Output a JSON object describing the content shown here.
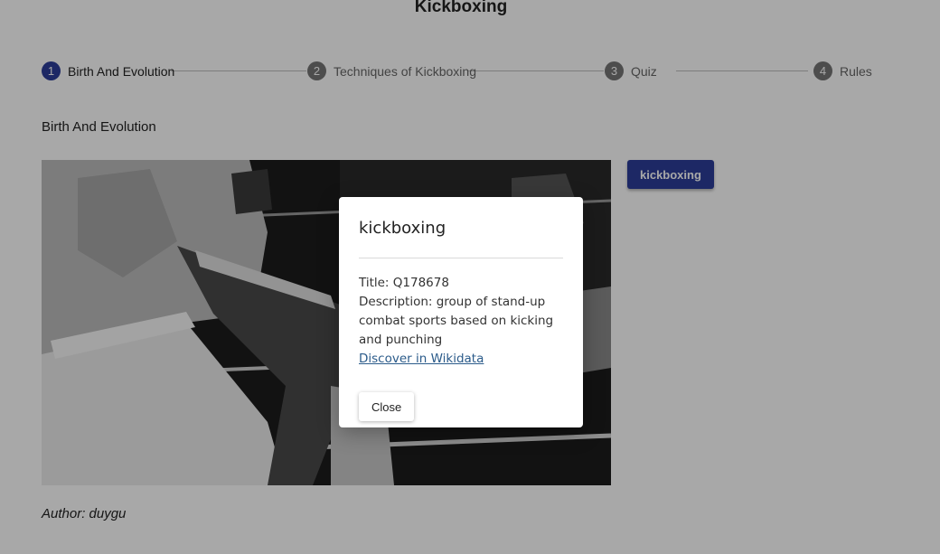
{
  "page": {
    "title": "Kickboxing"
  },
  "colors": {
    "primary": "#2c3e99",
    "step_inactive": "#757575",
    "overlay": "rgba(0,0,0,0.34)"
  },
  "stepper": {
    "steps": [
      {
        "number": "1",
        "label": "Birth And Evolution",
        "active": true
      },
      {
        "number": "2",
        "label": "Techniques of Kickboxing",
        "active": false
      },
      {
        "number": "3",
        "label": "Quiz",
        "active": false
      },
      {
        "number": "4",
        "label": "Rules",
        "active": false
      }
    ]
  },
  "section": {
    "title": "Birth And Evolution"
  },
  "photo": {
    "subject": "black-and-white photo of a kickboxing match in a ring"
  },
  "tag": {
    "label": "kickboxing"
  },
  "author": {
    "text": "Author: duygu"
  },
  "modal": {
    "title": "kickboxing",
    "title_line": "Title: Q178678",
    "description": "Description: group of stand-up combat sports based on kicking and punching",
    "link_label": "Discover in Wikidata",
    "close_label": "Close"
  }
}
